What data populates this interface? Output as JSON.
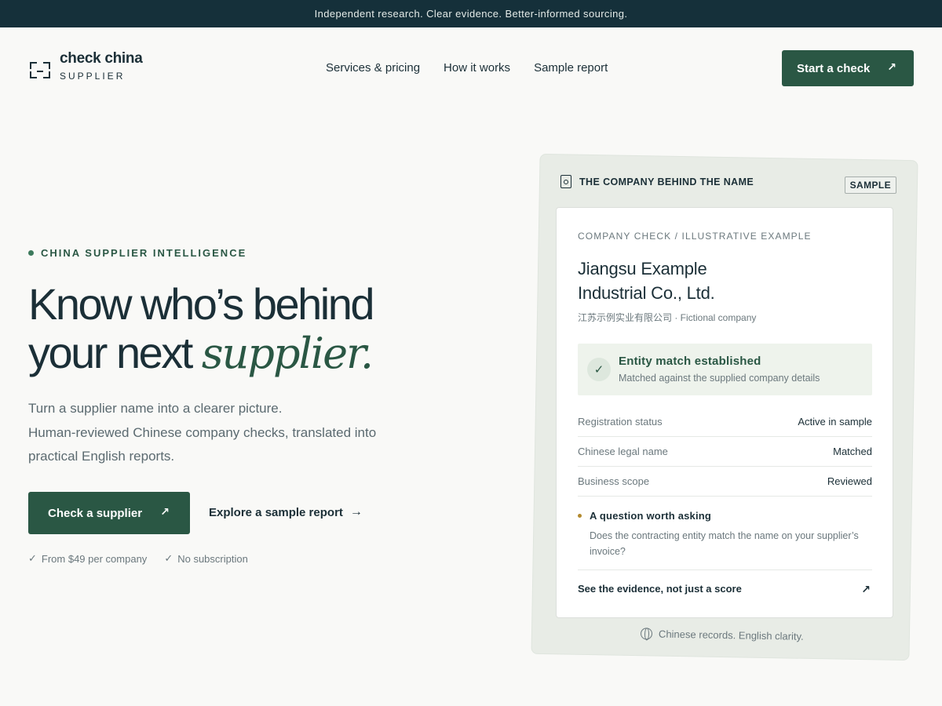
{
  "announcement": "Independent research. Clear evidence. Better-informed sourcing.",
  "brand": {
    "name": "check china",
    "tagline": "SUPPLIER"
  },
  "nav": {
    "items": [
      "Services & pricing",
      "How it works",
      "Sample report"
    ]
  },
  "header_cta": {
    "label": "Start a check",
    "icon": "arrow-up-right-icon"
  },
  "hero": {
    "eyebrow": "CHINA SUPPLIER INTELLIGENCE",
    "headline_line1": "Know who’s behind",
    "headline_line2_prefix": "your next ",
    "headline_line2_emphasis": "supplier.",
    "lede_line1": "Turn a supplier name into a clearer picture.",
    "lede_line2": "Human-reviewed Chinese company checks, translated into practical English reports.",
    "primary_cta": "Check a supplier",
    "secondary_cta": "Explore a sample report",
    "perks": [
      "From $49 per company",
      "No subscription"
    ]
  },
  "sample_card": {
    "header": "THE COMPANY BEHIND THE NAME",
    "badge": "SAMPLE",
    "kicker": "COMPANY CHECK / ILLUSTRATIVE EXAMPLE",
    "company_name_line1": "Jiangsu Example",
    "company_name_line2": "Industrial Co., Ltd.",
    "company_sub": "江苏示例实业有限公司 · Fictional company",
    "match_title": "Entity match established",
    "match_sub": "Matched against the supplied company details",
    "rows": [
      {
        "key": "Registration status",
        "value": "Active in sample"
      },
      {
        "key": "Chinese legal name",
        "value": "Matched"
      },
      {
        "key": "Business scope",
        "value": "Reviewed"
      }
    ],
    "question_title": "A question worth asking",
    "question_body": "Does the contracting entity match the name on your supplier’s invoice?",
    "evidence_link": "See the evidence, not just a score",
    "footnote": "Chinese records. English clarity."
  },
  "colors": {
    "accent": "#2a5744",
    "topbar": "#15303a",
    "text": "#1b2f37",
    "muted": "#6b787d",
    "question_dot": "#b38a2e"
  }
}
